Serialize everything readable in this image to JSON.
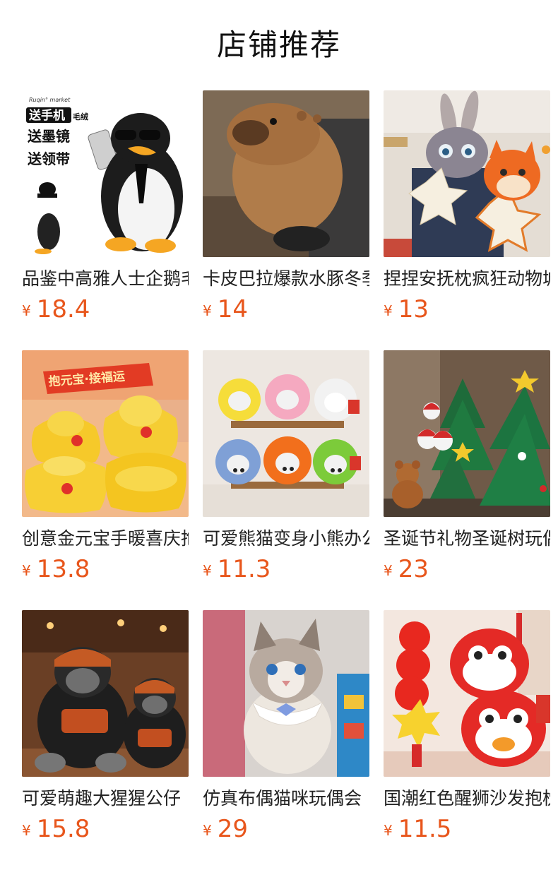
{
  "header": {
    "title": "店铺推荐"
  },
  "currency_symbol": "¥",
  "products": [
    {
      "name": "品鉴中高雅人士企鹅毛绒",
      "price": "18.4",
      "image": "penguin-plush",
      "overlay_brand": "Ruqin° market",
      "overlay_lines": [
        "送手机",
        "送墨镜",
        "送领带"
      ],
      "overlay_tag": "毛绒"
    },
    {
      "name": "卡皮巴拉爆款水豚冬季",
      "price": "14",
      "image": "capybara-plush"
    },
    {
      "name": "捏捏安抚枕疯狂动物城",
      "price": "13",
      "image": "bunny-fox-plush"
    },
    {
      "name": "创意金元宝手暖喜庆抱枕",
      "price": "13.8",
      "image": "gold-ingot-plush",
      "overlay_banner": "抱元宝·接福运"
    },
    {
      "name": "可爱熊猫变身小熊办公",
      "price": "11.3",
      "image": "bear-costume-plush"
    },
    {
      "name": "圣诞节礼物圣诞树玩偶",
      "price": "23",
      "image": "christmas-tree-plush"
    },
    {
      "name": "可爱萌趣大猩猩公仔",
      "price": "15.8",
      "image": "gorilla-plush"
    },
    {
      "name": "仿真布偶猫咪玩偶会",
      "price": "29",
      "image": "ragdoll-cat-plush"
    },
    {
      "name": "国潮红色醒狮沙发抱枕",
      "price": "11.5",
      "image": "lion-dance-plush"
    }
  ],
  "colors": {
    "price": "#e8561c",
    "title": "#111111",
    "text": "#222222"
  }
}
